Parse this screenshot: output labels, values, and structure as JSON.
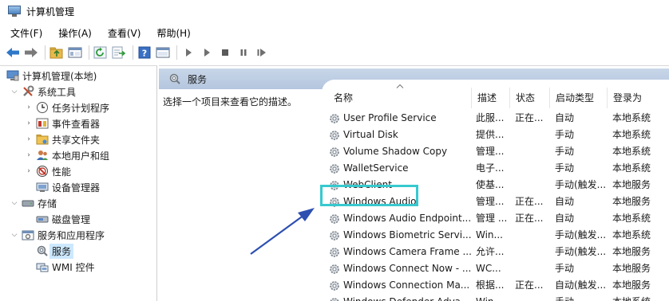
{
  "window": {
    "title": "计算机管理",
    "icon": "computer-management-icon"
  },
  "menu": [
    "文件(F)",
    "操作(A)",
    "查看(V)",
    "帮助(H)"
  ],
  "toolbar": {
    "buttons": [
      "back-icon",
      "forward-icon",
      "up-folder-icon",
      "show-hide-tree-icon",
      "refresh-icon",
      "export-list-icon",
      "help-icon",
      "properties-icon",
      "start-icon",
      "start-alt-icon",
      "stop-icon",
      "pause-icon",
      "restart-icon"
    ]
  },
  "tree": {
    "root": "计算机管理(本地)",
    "items": [
      {
        "label": "系统工具",
        "level": 1,
        "expanded": true,
        "icon": "tools-icon"
      },
      {
        "label": "任务计划程序",
        "level": 2,
        "icon": "clock-icon"
      },
      {
        "label": "事件查看器",
        "level": 2,
        "icon": "event-viewer-icon"
      },
      {
        "label": "共享文件夹",
        "level": 2,
        "icon": "shared-folder-icon"
      },
      {
        "label": "本地用户和组",
        "level": 2,
        "icon": "users-icon"
      },
      {
        "label": "性能",
        "level": 2,
        "icon": "performance-icon"
      },
      {
        "label": "设备管理器",
        "level": 2,
        "icon": "device-manager-icon"
      },
      {
        "label": "存储",
        "level": 1,
        "expanded": true,
        "icon": "storage-icon"
      },
      {
        "label": "磁盘管理",
        "level": 2,
        "icon": "disk-icon"
      },
      {
        "label": "服务和应用程序",
        "level": 1,
        "expanded": true,
        "icon": "services-apps-icon"
      },
      {
        "label": "服务",
        "level": 2,
        "icon": "services-icon",
        "selected": true
      },
      {
        "label": "WMI 控件",
        "level": 2,
        "icon": "wmi-icon"
      }
    ]
  },
  "pane": {
    "title": "服务",
    "description": "选择一个项目来查看它的描述。"
  },
  "columns": [
    "名称",
    "描述",
    "状态",
    "启动类型",
    "登录为"
  ],
  "services": [
    {
      "name": "User Profile Service",
      "desc": "此服...",
      "status": "正在...",
      "startup": "自动",
      "logon": "本地系统"
    },
    {
      "name": "Virtual Disk",
      "desc": "提供...",
      "status": "",
      "startup": "手动",
      "logon": "本地系统"
    },
    {
      "name": "Volume Shadow Copy",
      "desc": "管理...",
      "status": "",
      "startup": "手动",
      "logon": "本地系统"
    },
    {
      "name": "WalletService",
      "desc": "电子...",
      "status": "",
      "startup": "手动",
      "logon": "本地系统"
    },
    {
      "name": "WebClient",
      "desc": "使基...",
      "status": "",
      "startup": "手动(触发...",
      "logon": "本地服务"
    },
    {
      "name": "Windows Audio",
      "desc": "管理...",
      "status": "正在...",
      "startup": "自动",
      "logon": "本地服务"
    },
    {
      "name": "Windows Audio Endpoint...",
      "desc": "管理 ...",
      "status": "正在...",
      "startup": "自动",
      "logon": "本地系统"
    },
    {
      "name": "Windows Biometric Servi...",
      "desc": "Win...",
      "status": "",
      "startup": "手动(触发...",
      "logon": "本地系统"
    },
    {
      "name": "Windows Camera Frame ...",
      "desc": "允许...",
      "status": "",
      "startup": "手动(触发...",
      "logon": "本地服务"
    },
    {
      "name": "Windows Connect Now - ...",
      "desc": "WC...",
      "status": "",
      "startup": "手动",
      "logon": "本地服务"
    },
    {
      "name": "Windows Connection Ma...",
      "desc": "根据...",
      "status": "正在...",
      "startup": "自动(触发...",
      "logon": "本地服务"
    },
    {
      "name": "Windows Defender Adva...",
      "desc": "Win...",
      "status": "",
      "startup": "手动",
      "logon": "本地系统"
    }
  ],
  "colors": {
    "highlight_box": "#37c9cf",
    "annotation_arrow": "#2d4fb0",
    "pane_header": "#bccde3",
    "selection": "#cce8ff"
  }
}
